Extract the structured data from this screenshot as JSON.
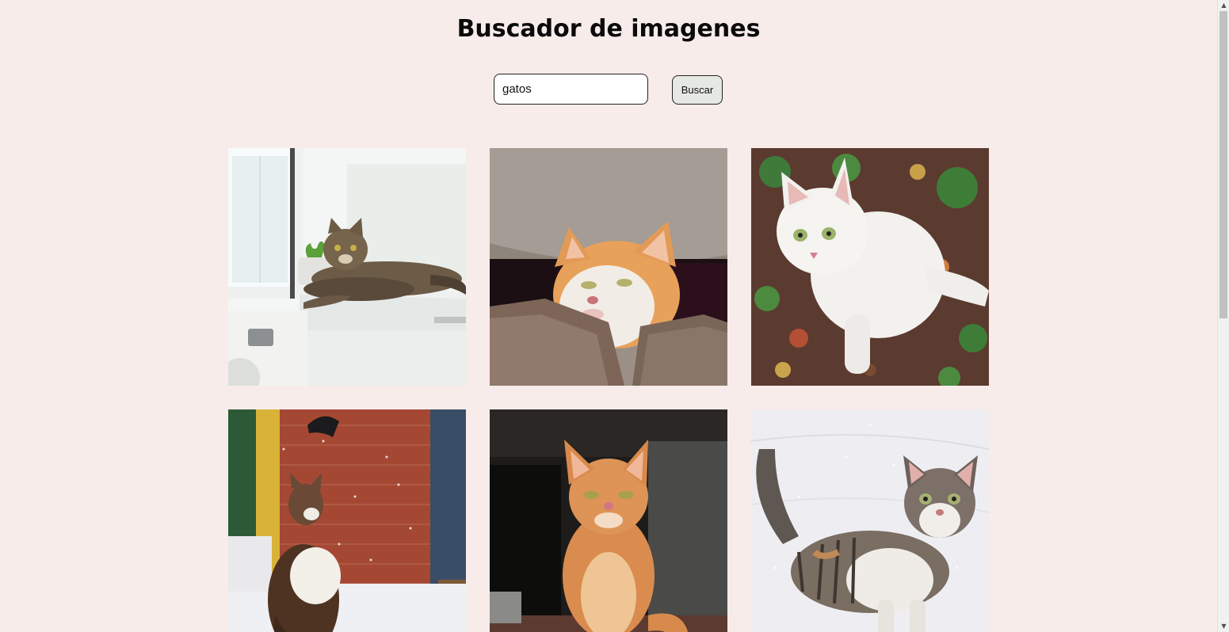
{
  "header": {
    "title": "Buscador de imagenes"
  },
  "search": {
    "value": "gatos",
    "button_label": "Buscar"
  },
  "results": [
    {
      "subject": "tabby cat lying on white kitchen counter"
    },
    {
      "subject": "orange and white kitten peeking under stone wall"
    },
    {
      "subject": "white cat sitting on autumn leaves"
    },
    {
      "subject": "long-haired cat looking up in the snow by brick wall"
    },
    {
      "subject": "ginger kitten sitting in front of dark doorway"
    },
    {
      "subject": "calico tabby cat standing in snow"
    }
  ],
  "colors": {
    "background": "#f7ecea",
    "button": "#e6e8e3"
  }
}
